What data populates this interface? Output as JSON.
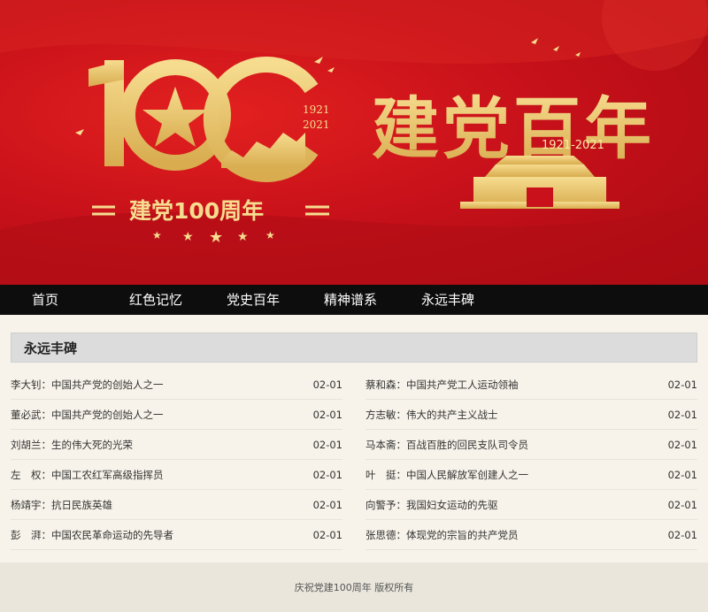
{
  "banner": {
    "logo_years": [
      "1921",
      "2021"
    ],
    "logo_caption": "建党100周年",
    "logo_number": "100",
    "title": "建党百年",
    "title_years": "1921-2021",
    "colors": {
      "red": "#c8111a",
      "gold": "#e9c46a"
    }
  },
  "nav": {
    "items": [
      "首页",
      "红色记忆",
      "党史百年",
      "精神谱系",
      "永远丰碑"
    ]
  },
  "section": {
    "title": "永远丰碑"
  },
  "left_list": [
    {
      "title": "李大钊：中国共产党的创始人之一",
      "date": "02-01"
    },
    {
      "title": "董必武：中国共产党的创始人之一",
      "date": "02-01"
    },
    {
      "title": "刘胡兰：生的伟大死的光荣",
      "date": "02-01"
    },
    {
      "title": "左　权：中国工农红军高级指挥员",
      "date": "02-01"
    },
    {
      "title": "杨靖宇：抗日民族英雄",
      "date": "02-01"
    },
    {
      "title": "彭　湃：中国农民革命运动的先导者",
      "date": "02-01"
    }
  ],
  "right_list": [
    {
      "title": "蔡和森：中国共产党工人运动领袖",
      "date": "02-01"
    },
    {
      "title": "方志敏：伟大的共产主义战士",
      "date": "02-01"
    },
    {
      "title": "马本斋：百战百胜的回民支队司令员",
      "date": "02-01"
    },
    {
      "title": "叶　挺：中国人民解放军创建人之一",
      "date": "02-01"
    },
    {
      "title": "向警予：我国妇女运动的先驱",
      "date": "02-01"
    },
    {
      "title": "张思德：体现党的宗旨的共产党员",
      "date": "02-01"
    }
  ],
  "footer": {
    "text": "庆祝党建100周年 版权所有"
  }
}
